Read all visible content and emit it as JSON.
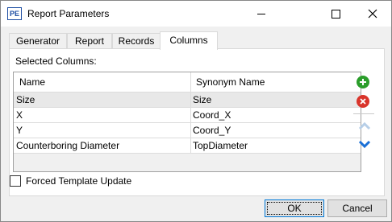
{
  "window": {
    "app_icon_text": "PE",
    "title": "Report Parameters"
  },
  "tabs": [
    {
      "label": "Generator",
      "active": false
    },
    {
      "label": "Report",
      "active": false
    },
    {
      "label": "Records",
      "active": false
    },
    {
      "label": "Columns",
      "active": true
    }
  ],
  "columns_panel": {
    "selected_label": "Selected Columns:",
    "headers": [
      "Name",
      "Synonym Name"
    ],
    "rows": [
      {
        "name": "Size",
        "synonym": "Size",
        "selected": true
      },
      {
        "name": "X",
        "synonym": "Coord_X",
        "selected": false
      },
      {
        "name": "Y",
        "synonym": "Coord_Y",
        "selected": false
      },
      {
        "name": "Counterboring Diameter",
        "synonym": "TopDiameter",
        "selected": false
      }
    ],
    "side_buttons": {
      "add_icon": "plus-circle-icon",
      "delete_icon": "x-circle-icon",
      "up_icon": "chevron-up-icon",
      "down_icon": "chevron-down-icon"
    }
  },
  "forced_update": {
    "label": "Forced Template Update",
    "checked": false
  },
  "buttons": {
    "ok": "OK",
    "cancel": "Cancel"
  },
  "colors": {
    "accent": "#0078d7",
    "add": "#2a9d2a",
    "delete": "#d9342b",
    "arrow_disabled": "#b7cfe8",
    "arrow_active": "#1a6fd6"
  }
}
